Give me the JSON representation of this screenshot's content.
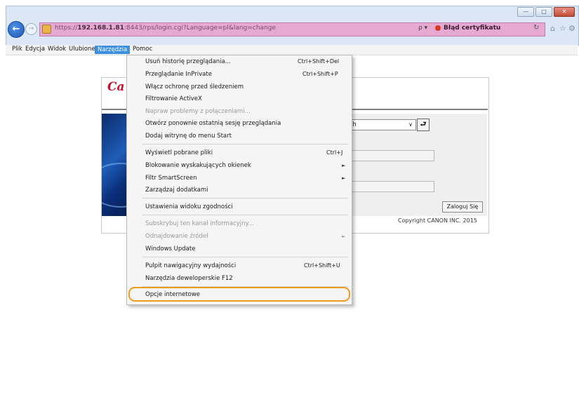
{
  "window": {
    "buttons": [
      "—",
      "□",
      "✕"
    ]
  },
  "address": {
    "url_prefix": "https://",
    "url_host": "192.168.1.81",
    "url_rest": ":8443/rps/login.cgi?Language=pl&lang=change",
    "search_glyph": "ρ ▾",
    "cert_error": "Błąd certyfikatu",
    "refresh_glyph": "↻",
    "back_glyph": "←",
    "forward_glyph": "→"
  },
  "menubar": {
    "items": [
      "Plik",
      "Edycja",
      "Widok",
      "Ulubione",
      "Narzędzia",
      "Pomoc"
    ]
  },
  "page": {
    "logo": "Ca",
    "language_value": "sh",
    "go_glyph": "⮐",
    "login_label": "Zaloguj Się",
    "copyright": "Copyright CANON INC. 2015"
  },
  "tools_menu": {
    "items": [
      {
        "label": "Usuń historię przeglądania...",
        "shortcut": "Ctrl+Shift+Del"
      },
      {
        "label": "Przeglądanie InPrivate",
        "shortcut": "Ctrl+Shift+P"
      },
      {
        "label": "Włącz ochronę przed śledzeniem",
        "shortcut": ""
      },
      {
        "label": "Filtrowanie ActiveX",
        "shortcut": ""
      },
      {
        "label": "Napraw problemy z połączeniami...",
        "shortcut": ""
      },
      {
        "label": "Otwórz ponownie ostatnią sesję przeglądania",
        "shortcut": ""
      },
      {
        "label": "Dodaj witrynę do menu Start",
        "shortcut": ""
      },
      {
        "label": "Wyświetl pobrane pliki",
        "shortcut": "Ctrl+J"
      },
      {
        "label": "Blokowanie wyskakujących okienek",
        "shortcut": ""
      },
      {
        "label": "Filtr SmartScreen",
        "shortcut": ""
      },
      {
        "label": "Zarządzaj dodatkami",
        "shortcut": ""
      },
      {
        "label": "Ustawienia widoku zgodności",
        "shortcut": ""
      },
      {
        "label": "Subskrybuj ten kanał informacyjny...",
        "shortcut": ""
      },
      {
        "label": "Odnajdowanie źródeł",
        "shortcut": ""
      },
      {
        "label": "Windows Update",
        "shortcut": ""
      },
      {
        "label": "Pulpit nawigacyjny wydajności",
        "shortcut": "Ctrl+Shift+U"
      },
      {
        "label": "Narzędzia deweloperskie F12",
        "shortcut": ""
      },
      {
        "label": "Opcje internetowe",
        "shortcut": ""
      }
    ],
    "submenu_glyph": "►"
  }
}
